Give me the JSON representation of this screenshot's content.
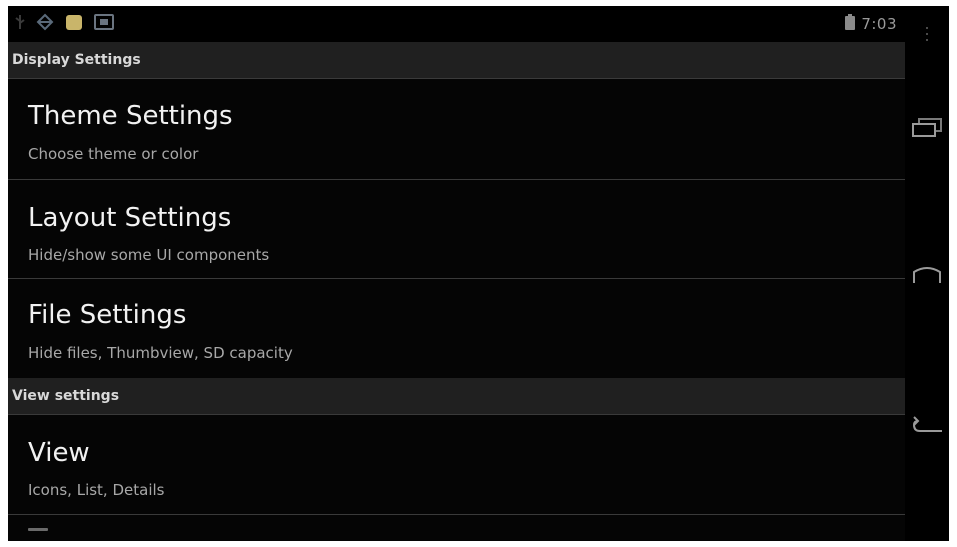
{
  "status_bar": {
    "icons": [
      "usb-icon",
      "debug-icon",
      "android-icon",
      "gallery-icon",
      "battery-icon"
    ],
    "time": "7:03"
  },
  "sections": [
    {
      "header": "Display Settings",
      "items": [
        {
          "title": "Theme Settings",
          "summary": "Choose theme or color"
        },
        {
          "title": "Layout Settings",
          "summary": "Hide/show some UI components"
        },
        {
          "title": "File Settings",
          "summary": "Hide files, Thumbview, SD capacity"
        }
      ]
    },
    {
      "header": "View settings",
      "items": [
        {
          "title": "View",
          "summary": "Icons, List, Details"
        }
      ]
    }
  ],
  "navigation_bar": {
    "buttons": [
      "menu-icon",
      "recent-apps-icon",
      "home-icon",
      "back-icon"
    ]
  },
  "colors": {
    "background": "#050505",
    "section_header_bg": "#202020",
    "title_text": "#f2f2f2",
    "summary_text": "#a8a8a8",
    "android_icon": "#c9b56a"
  }
}
